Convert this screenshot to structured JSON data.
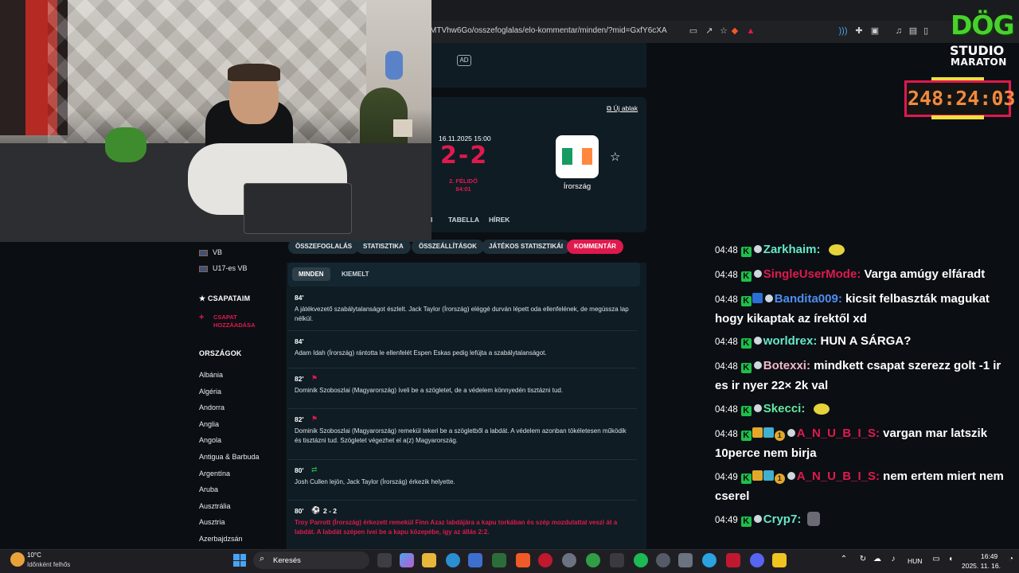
{
  "browser": {
    "url": "MTVhw6Go/osszefoglalas/elo-kommentar/minden/?mid=GxfY6cXA"
  },
  "site": {
    "ad_label": "AD",
    "new_window_label": "Új ablak",
    "sidebar": {
      "competitions": [
        {
          "label": "VB"
        },
        {
          "label": "U17-es VB"
        }
      ],
      "my_teams_label": "CSAPATAIM",
      "add_team_label_line1": "CSAPAT",
      "add_team_label_line2": "HOZZÁADÁSA",
      "countries_label": "ORSZÁGOK",
      "countries": [
        "Albánia",
        "Algéria",
        "Andorra",
        "Anglia",
        "Angola",
        "Antigua & Barbuda",
        "Argentína",
        "Aruba",
        "Ausztrália",
        "Ausztria",
        "Azerbajdzsán"
      ]
    },
    "match": {
      "date": "16.11.2025 15:00",
      "score": "2-2",
      "status_line1": "2. FÉLIDŐ",
      "status_line2": "84:01",
      "away_team": "Írország",
      "flag_colors": [
        "#169b62",
        "#ffffff",
        "#ff883e"
      ],
      "sub_tabs": [
        "I",
        "TABELLA",
        "HÍREK"
      ]
    },
    "main_tabs": [
      {
        "label": "ÖSSZEFOGLALÁS",
        "active": false
      },
      {
        "label": "STATISZTIKA",
        "active": false
      },
      {
        "label": "ÖSSZEÁLLÍTÁSOK",
        "active": false
      },
      {
        "label": "JÁTÉKOS STATISZTIKÁI",
        "active": false
      },
      {
        "label": "KOMMENTÁR",
        "active": true
      }
    ],
    "filters": [
      {
        "label": "MINDEN",
        "active": true
      },
      {
        "label": "KIEMELT",
        "active": false
      }
    ],
    "commentary": [
      {
        "minute": "84'",
        "icon": "",
        "text": "A játékvezető szabálytalanságot észlelt. Jack Taylor (Írország) eléggé durván lépett oda ellenfelének, de megússza lap nélkül.",
        "highlight": false
      },
      {
        "minute": "84'",
        "icon": "",
        "text": "Adam Idah (Írország) rántotta le ellenfelét Espen Eskas pedig lefújta a szabálytalanságot.",
        "highlight": false
      },
      {
        "minute": "82'",
        "icon": "corner-flag",
        "text": "Dominik Szoboszlai (Magyarország) íveli be a szögletet, de a védelem könnyedén tisztázni tud.",
        "highlight": false
      },
      {
        "minute": "82'",
        "icon": "corner-flag",
        "text": "Dominik Szoboszlai (Magyarország) remekül tekeri be a szögletből a labdát. A védelem azonban tökéletesen működik és tisztázni tud. Szögletet végezhet el a(z) Magyarország.",
        "highlight": false
      },
      {
        "minute": "80'",
        "icon": "substitution",
        "text": "Josh Cullen lejön, Jack Taylor (Írország) érkezik helyette.",
        "highlight": false
      },
      {
        "minute": "80'",
        "icon": "goal",
        "score": "2 - 2",
        "text": "Troy Parrott (Írország) érkezett remekül Finn Azaz labdájára a kapu torkában és szép mozdulattal veszi át a labdát. A labdát szépen ívei be a kapu közepébe, így az állás 2:2.",
        "highlight": true
      }
    ]
  },
  "chat": [
    {
      "time": "04:48",
      "user": "Zarkhaim",
      "color": "#67e8c9",
      "message": "",
      "emote": true,
      "badges": [
        "k"
      ]
    },
    {
      "time": "04:48",
      "user": "SingleUserMode",
      "color": "#e0194d",
      "message": "Varga amúgy elfáradt",
      "emote": false,
      "badges": [
        "k"
      ]
    },
    {
      "time": "04:48",
      "user": "Bandita009",
      "color": "#4f8df0",
      "message": "kicsit felbaszták magukat hogy kikaptak az írektől xd",
      "emote": false,
      "badges": [
        "k",
        "blue"
      ]
    },
    {
      "time": "04:48",
      "user": "worldrex",
      "color": "#67e8c9",
      "message": "HUN A SÁRGA?",
      "emote": false,
      "badges": [
        "k"
      ]
    },
    {
      "time": "04:48",
      "user": "Botexxi",
      "color": "#f2b8c6",
      "message": "mindkett csapat szerezz golt -1 ir es ir nyer 22× 2k val",
      "emote": false,
      "badges": [
        "k"
      ]
    },
    {
      "time": "04:48",
      "user": "Skecci",
      "color": "#67e8a0",
      "message": "",
      "emote": true,
      "badges": [
        "k"
      ]
    },
    {
      "time": "04:48",
      "user": "A_N_U_B_I_S",
      "color": "#e0194d",
      "message": "vargan mar latszik 10perce nem birja",
      "emote": false,
      "badges": [
        "k",
        "crown",
        "gem",
        "one"
      ]
    },
    {
      "time": "04:49",
      "user": "A_N_U_B_I_S",
      "color": "#e0194d",
      "message": "nem ertem miert nem cserel",
      "emote": false,
      "badges": [
        "k",
        "crown",
        "gem",
        "one"
      ]
    },
    {
      "time": "04:49",
      "user": "Cryp7",
      "color": "#67e8c9",
      "message": "",
      "emote": true,
      "badges": [
        "k"
      ]
    }
  ],
  "overlay": {
    "logo_line1": "DÖG",
    "logo_line2": "STUDIO",
    "logo_line3": "MARATON",
    "timer": "248:24:03"
  },
  "taskbar": {
    "weather_temp": "10°C",
    "weather_desc": "Időnként felhős",
    "search_label": "Keresés",
    "language": "HUN",
    "time": "16:49",
    "date": "2025. 11. 16."
  }
}
